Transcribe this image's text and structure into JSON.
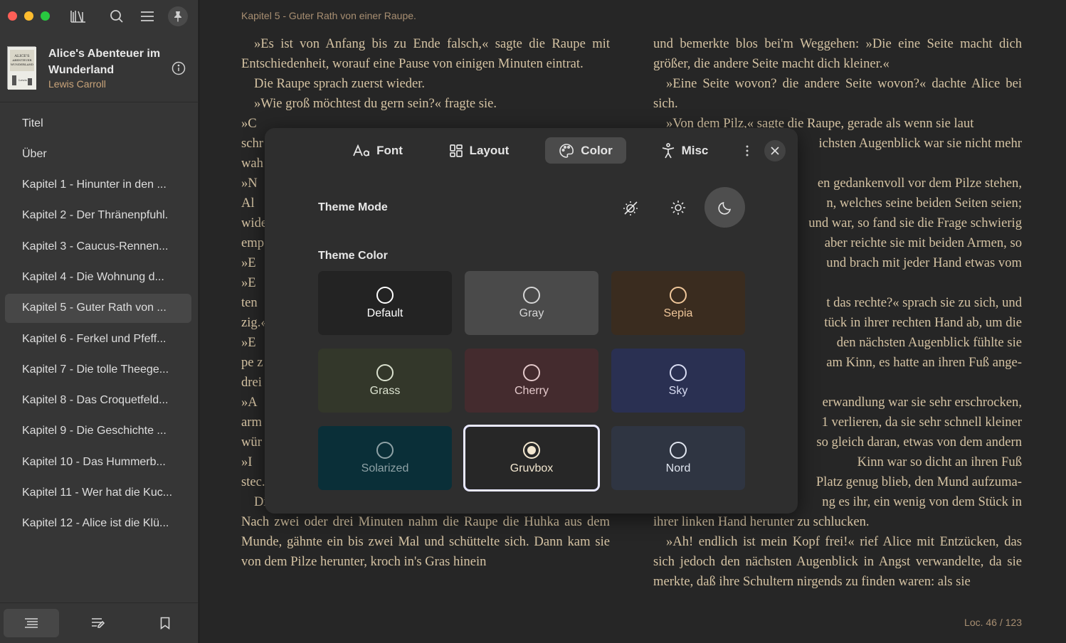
{
  "sidebar": {
    "book": {
      "title": "Alice's Abenteuer im Wunderland",
      "author": "Lewis Carroll"
    },
    "toc": [
      {
        "label": "Titel",
        "active": false
      },
      {
        "label": "Über",
        "active": false
      },
      {
        "label": "Kapitel 1 - Hinunter in den ...",
        "active": false
      },
      {
        "label": "Kapitel 2 - Der Thränenpfuhl.",
        "active": false
      },
      {
        "label": "Kapitel 3 - Caucus-Rennen...",
        "active": false
      },
      {
        "label": "Kapitel 4 - Die Wohnung d...",
        "active": false
      },
      {
        "label": "Kapitel 5 - Guter Rath von ...",
        "active": true
      },
      {
        "label": "Kapitel 6 - Ferkel und Pfeff...",
        "active": false
      },
      {
        "label": "Kapitel 7 - Die tolle Theege...",
        "active": false
      },
      {
        "label": "Kapitel 8 - Das Croquetfeld...",
        "active": false
      },
      {
        "label": "Kapitel 9 - Die Geschichte ...",
        "active": false
      },
      {
        "label": "Kapitel 10 - Das Hummerb...",
        "active": false
      },
      {
        "label": "Kapitel 11 - Wer hat die Kuc...",
        "active": false
      },
      {
        "label": "Kapitel 12 - Alice ist die Klü...",
        "active": false
      }
    ]
  },
  "reader": {
    "chapter_header": "Kapitel 5 - Guter Rath von einer Raupe.",
    "location": "Loc. 46 / 123",
    "left_top": [
      "»Es ist von Anfang bis zu Ende falsch,« sagte die Raupe mit Entschiedenheit, worauf eine Pause von einigen Minuten eintrat.",
      "Die Raupe sprach zuerst wieder.",
      "»Wie groß möchtest du gern sein?« fragte sie."
    ],
    "left_fragments": [
      "»C",
      "schr",
      "wah",
      "»N",
      "Al",
      "wide",
      "emp",
      "»E",
      "»E",
      "ten",
      "zig.«",
      "»E",
      "pe z",
      "drei",
      "»A",
      "arm",
      "wür",
      "»I",
      "stec."
    ],
    "left_bottom": [
      "Diesmal wartete Alice geduldig, bis es ihr gefällig wäre zu reden. Nach zwei oder drei Minuten nahm die Raupe die Huhka aus dem Munde, gähnte ein bis zwei Mal und schüttelte sich. Dann kam sie von dem Pilze herunter, kroch in's Gras hinein"
    ],
    "right_top": [
      "und bemerkte blos bei'm Weggehen: »Die eine Seite macht dich größer, die andere Seite macht dich kleiner.«",
      "»Eine Seite wovon? die andere Seite wovon?« dachte Alice bei sich.",
      "»Von dem Pilz,« sagte die Raupe, gerade als wenn sie laut"
    ],
    "right_fragments": [
      "ichsten Augenblick war sie nicht mehr",
      "",
      "en gedankenvoll vor dem Pilze stehen,",
      "n, welches seine beiden Seiten seien;",
      "und war, so fand sie die Frage schwierig",
      "aber reichte sie mit beiden Armen, so",
      "und brach mit jeder Hand etwas vom",
      "",
      "t das rechte?« sprach sie zu sich, und",
      "tück in ihrer rechten Hand ab, um die",
      "den nächsten Augenblick fühlte sie",
      "am Kinn, es hatte an ihren Fuß ange-",
      "",
      "erwandlung war sie sehr erschrocken,",
      "1 verlieren, da sie sehr schnell kleiner",
      "so gleich daran, etwas von dem andern",
      "Kinn war so dicht an ihren Fuß",
      "Platz genug blieb, den Mund aufzuma-",
      "ng es ihr, ein wenig von dem Stück in"
    ],
    "right_bottom": [
      "ihrer linken Hand herunter zu schlucken.",
      "»Ah! endlich ist mein Kopf frei!« rief Alice mit Entzücken, das sich jedoch den nächsten Augenblick in Angst verwandelte, da sie merkte, daß ihre Schultern nirgends zu finden waren: als sie"
    ]
  },
  "panel": {
    "tabs": [
      {
        "label": "Font",
        "icon": "font-icon",
        "active": false
      },
      {
        "label": "Layout",
        "icon": "layout-icon",
        "active": false
      },
      {
        "label": "Color",
        "icon": "palette-icon",
        "active": true
      },
      {
        "label": "Misc",
        "icon": "accessibility-icon",
        "active": false
      }
    ],
    "theme_mode_label": "Theme Mode",
    "theme_modes": [
      {
        "icon": "auto-theme-icon",
        "active": false
      },
      {
        "icon": "sun-icon",
        "active": false
      },
      {
        "icon": "moon-icon",
        "active": true
      }
    ],
    "theme_color_label": "Theme Color",
    "swatches": [
      {
        "name": "Default",
        "bg": "#232323",
        "fg": "#ffffff",
        "selected": false
      },
      {
        "name": "Gray",
        "bg": "#4a4a4a",
        "fg": "#d6d6d6",
        "selected": false
      },
      {
        "name": "Sepia",
        "bg": "#3a2c1f",
        "fg": "#f0c79a",
        "selected": false
      },
      {
        "name": "Grass",
        "bg": "#33372a",
        "fg": "#dbe2cf",
        "selected": false
      },
      {
        "name": "Cherry",
        "bg": "#442b2e",
        "fg": "#e4c9cb",
        "selected": false
      },
      {
        "name": "Sky",
        "bg": "#2a3052",
        "fg": "#d8dcf2",
        "selected": false
      },
      {
        "name": "Solarized",
        "bg": "#0a2f38",
        "fg": "#8fa2a6",
        "selected": false
      },
      {
        "name": "Gruvbox",
        "bg": "#272727",
        "fg": "#f2e6cf",
        "selected": true
      },
      {
        "name": "Nord",
        "bg": "#2f3542",
        "fg": "#e0e5ef",
        "selected": false
      }
    ]
  },
  "colors": {
    "accent_outline": "#e9e9ff",
    "sidebar_bg": "#363636",
    "reader_bg": "#262626",
    "text": "#d5c3a3"
  }
}
